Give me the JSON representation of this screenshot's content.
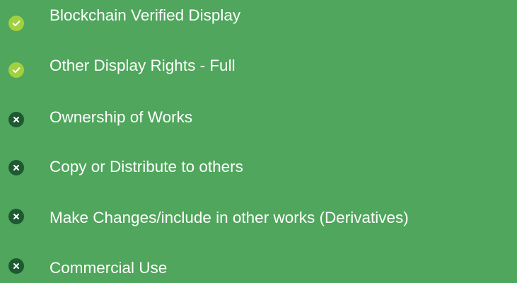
{
  "colors": {
    "background": "#4fa65c",
    "check_badge": "#a3d03e",
    "cross_badge": "#1d5a31",
    "text": "#ffffff"
  },
  "features": [
    {
      "label": "Blockchain Verified Display",
      "included": true,
      "icon": "check-circle-icon"
    },
    {
      "label": "Other Display Rights - Full",
      "included": true,
      "icon": "check-circle-icon"
    },
    {
      "label": "Ownership of Works",
      "included": false,
      "icon": "x-circle-icon"
    },
    {
      "label": "Copy or Distribute to others",
      "included": false,
      "icon": "x-circle-icon"
    },
    {
      "label": "Make Changes/include in other works (Derivatives)",
      "included": false,
      "icon": "x-circle-icon"
    },
    {
      "label": "Commercial Use",
      "included": false,
      "icon": "x-circle-icon"
    }
  ]
}
